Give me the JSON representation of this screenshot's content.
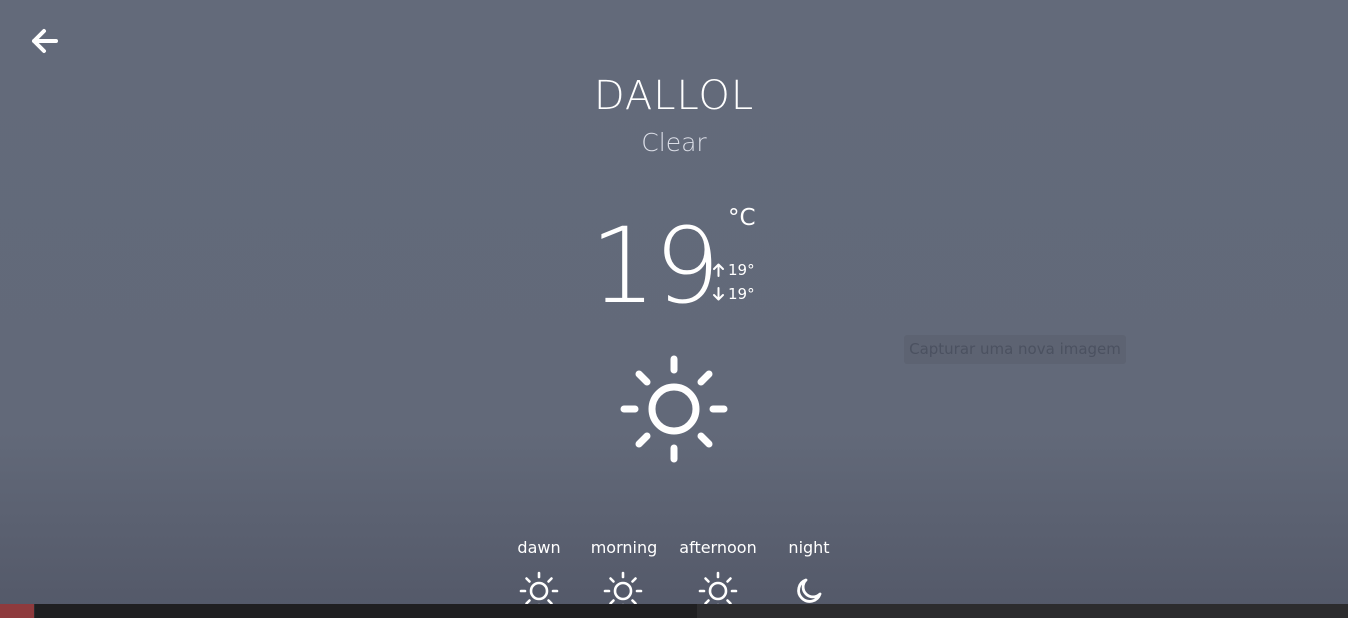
{
  "header": {
    "back_icon": "arrow-left-icon"
  },
  "location": {
    "city": "DALLOL",
    "condition": "Clear"
  },
  "temperature": {
    "current": "19",
    "unit": "°C",
    "high": "19°",
    "low": "19°"
  },
  "main_icon": "sun-icon",
  "tooltip": {
    "text": "Capturar uma nova imagem"
  },
  "periods": [
    {
      "label": "dawn",
      "icon": "sun-icon"
    },
    {
      "label": "morning",
      "icon": "sun-icon"
    },
    {
      "label": "afternoon",
      "icon": "sun-icon"
    },
    {
      "label": "night",
      "icon": "moon-icon"
    }
  ],
  "colors": {
    "background": "#636a7a",
    "text": "#ffffff",
    "taskbar": "#2c2c2e",
    "taskbar_accent": "#8e3a3d"
  }
}
